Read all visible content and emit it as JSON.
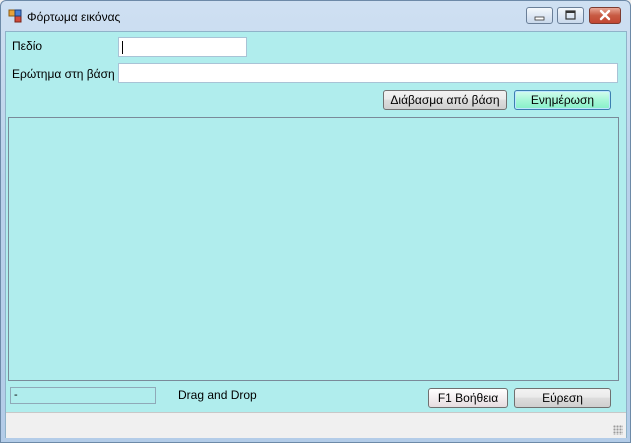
{
  "window": {
    "title": "Φόρτωμα εικόνας"
  },
  "form": {
    "field_label": "Πεδίο",
    "field_value": "",
    "query_label": "Ερώτημα στη βάση",
    "query_value": ""
  },
  "buttons": {
    "read_from_db": "Διάβασμα από βάση",
    "update": "Ενημέρωση",
    "help": "F1 Βοήθεια",
    "find": "Εύρεση"
  },
  "status": {
    "value": "-",
    "drag_drop": "Drag and Drop"
  },
  "colors": {
    "client_bg": "#b0eded",
    "update_button": "#a8f7d8"
  }
}
